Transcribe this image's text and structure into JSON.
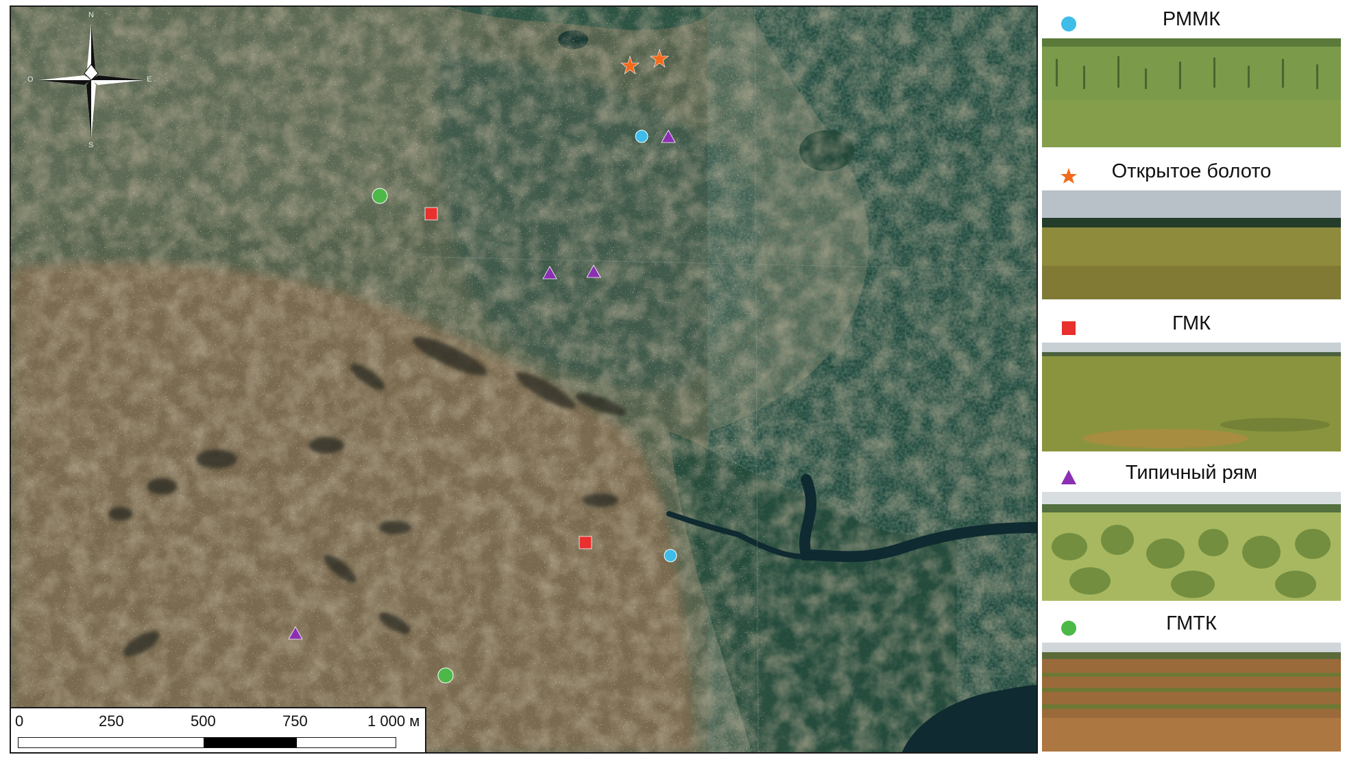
{
  "compass": {
    "north": "N",
    "south": "S",
    "east": "E",
    "west": "O",
    "icon": "compass-rose-icon"
  },
  "scale_bar": {
    "labels": [
      "0",
      "250",
      "500",
      "750",
      "1 000 м"
    ]
  },
  "legend": [
    {
      "id": "rmmk",
      "label": "РММК",
      "symbol": "circle",
      "color": "#3dbde8"
    },
    {
      "id": "open",
      "label": "Открытое болото",
      "symbol": "star",
      "color": "#f26a1b"
    },
    {
      "id": "gmk",
      "label": "ГМК",
      "symbol": "square",
      "color": "#e8302e"
    },
    {
      "id": "ryam",
      "label": "Типичный рям",
      "symbol": "triangle",
      "color": "#8b2fb3"
    },
    {
      "id": "gmtk",
      "label": "ГМТК",
      "symbol": "circle",
      "color": "#4cb848"
    }
  ],
  "colors": {
    "bog_brown": "#7a6a4e",
    "bog_green": "#46604a",
    "forest": "#1e4436",
    "water": "#0e2a30",
    "lichen": "#c9c7ba"
  }
}
